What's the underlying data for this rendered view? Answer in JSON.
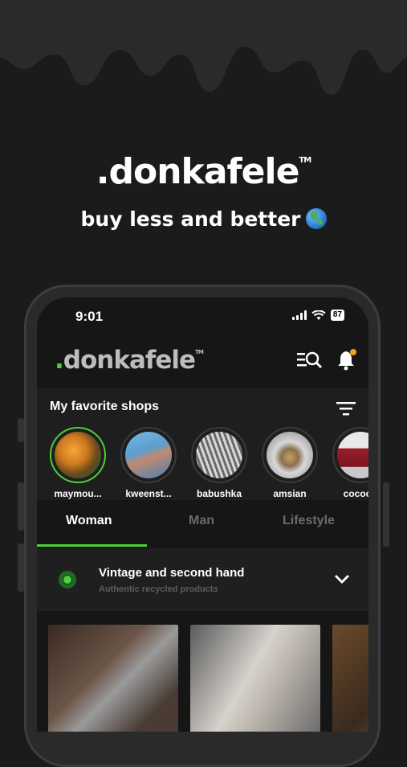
{
  "hero": {
    "logo": ".donkafele",
    "tm": "TM",
    "tagline": "buy less and better"
  },
  "status": {
    "time": "9:01",
    "battery": "87"
  },
  "app": {
    "logo_dot": ".",
    "logo_text": "donkafele",
    "tm": "TM"
  },
  "favorites": {
    "title": "My favorite shops",
    "shops": [
      {
        "name": "maymou..."
      },
      {
        "name": "kweenst..."
      },
      {
        "name": "babushka"
      },
      {
        "name": "amsian"
      },
      {
        "name": "cocooo"
      }
    ]
  },
  "tabs": [
    "Woman",
    "Man",
    "Lifestyle"
  ],
  "category": {
    "title": "Vintage and second hand",
    "subtitle": "Authentic recycled products"
  },
  "colors": {
    "accent": "#4cd137",
    "background": "#1b1b1b"
  },
  "icons": [
    "search-list-icon",
    "bell-icon",
    "filter-icon",
    "chevron-down-icon",
    "globe-icon"
  ]
}
